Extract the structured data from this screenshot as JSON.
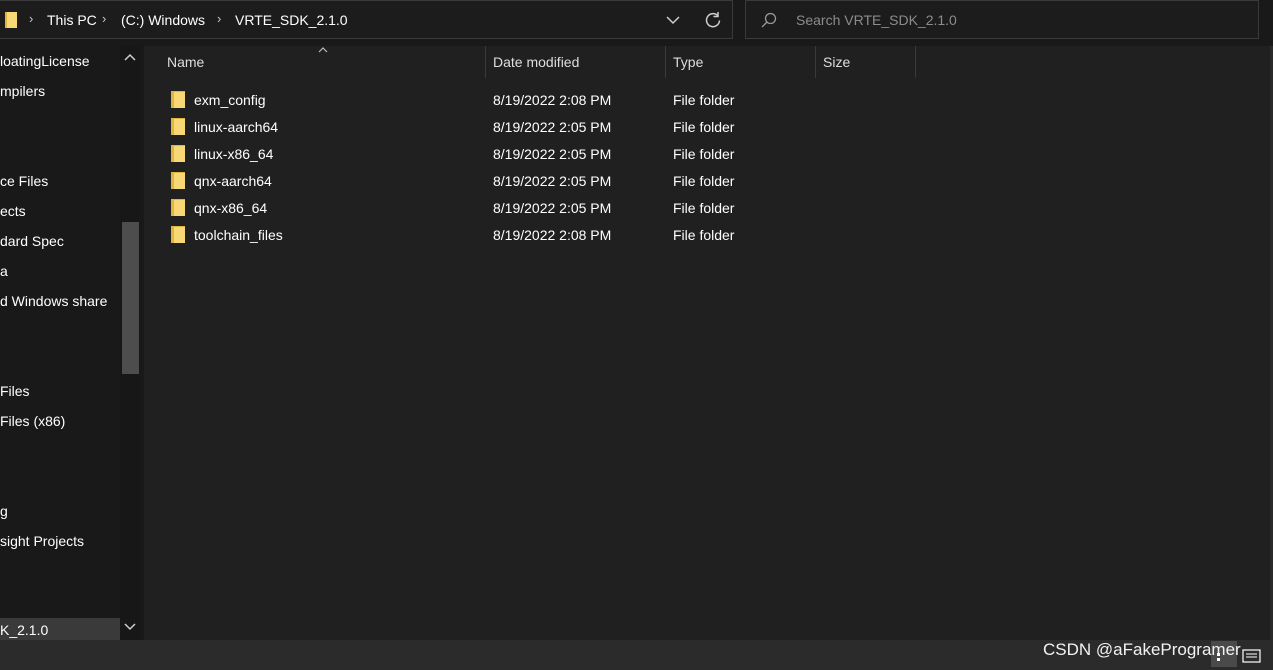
{
  "address": {
    "crumbs": [
      "This PC",
      "(C:) Windows",
      "VRTE_SDK_2.1.0"
    ],
    "separator": "›"
  },
  "search": {
    "placeholder": "Search VRTE_SDK_2.1.0"
  },
  "nav": {
    "items": [
      "loatingLicense",
      "mpilers",
      "ce Files",
      "ects",
      "dard Spec",
      "a",
      "d Windows share",
      "Files",
      "Files (x86)",
      "g",
      "sight Projects",
      "K_2.1.0"
    ]
  },
  "columns": [
    "Name",
    "Date modified",
    "Type",
    "Size"
  ],
  "files": [
    {
      "name": "exm_config",
      "date": "8/19/2022 2:08 PM",
      "type": "File folder",
      "size": ""
    },
    {
      "name": "linux-aarch64",
      "date": "8/19/2022 2:05 PM",
      "type": "File folder",
      "size": ""
    },
    {
      "name": "linux-x86_64",
      "date": "8/19/2022 2:05 PM",
      "type": "File folder",
      "size": ""
    },
    {
      "name": "qnx-aarch64",
      "date": "8/19/2022 2:05 PM",
      "type": "File folder",
      "size": ""
    },
    {
      "name": "qnx-x86_64",
      "date": "8/19/2022 2:05 PM",
      "type": "File folder",
      "size": ""
    },
    {
      "name": "toolchain_files",
      "date": "8/19/2022 2:08 PM",
      "type": "File folder",
      "size": ""
    }
  ],
  "watermark": "CSDN @aFakeProgramer",
  "icons": {
    "folder": "folder-icon",
    "search": "search-icon",
    "refresh": "refresh-icon",
    "dropdown": "chevron-down-icon"
  },
  "colors": {
    "folder": "#f8d775",
    "folder_dark": "#e0b53f",
    "background": "#202020"
  }
}
